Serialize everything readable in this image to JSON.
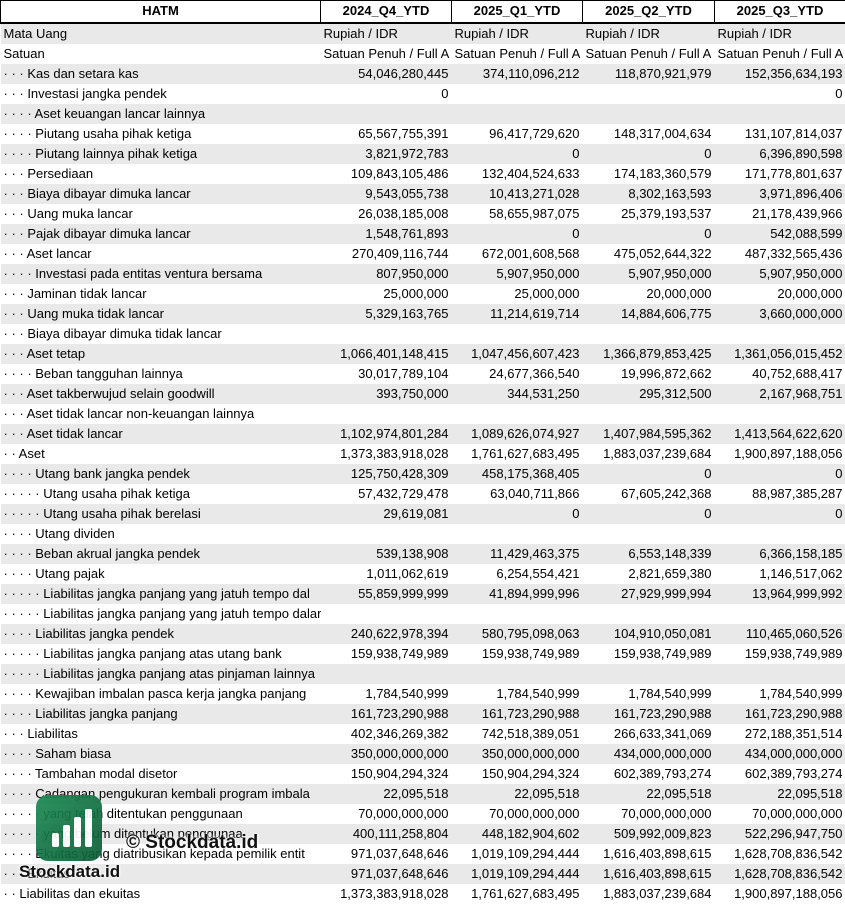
{
  "table": {
    "headers": [
      "HATM",
      "2024_Q4_YTD",
      "2025_Q1_YTD",
      "2025_Q2_YTD",
      "2025_Q3_YTD"
    ],
    "rows": [
      [
        "Mata Uang",
        "Rupiah / IDR",
        "Rupiah / IDR",
        "Rupiah / IDR",
        "Rupiah / IDR"
      ],
      [
        "Satuan",
        "Satuan Penuh / Full A",
        "Satuan Penuh / Full A",
        "Satuan Penuh / Full A",
        "Satuan Penuh / Full A"
      ],
      [
        "· · · Kas dan setara kas",
        "54,046,280,445",
        "374,110,096,212",
        "118,870,921,979",
        "152,356,634,193"
      ],
      [
        "· · · Investasi jangka pendek",
        "0",
        "",
        "",
        "0"
      ],
      [
        "· · · · Aset keuangan lancar lainnya",
        "",
        "",
        "",
        ""
      ],
      [
        "· · · · Piutang usaha pihak ketiga",
        "65,567,755,391",
        "96,417,729,620",
        "148,317,004,634",
        "131,107,814,037"
      ],
      [
        "· · · · Piutang lainnya pihak ketiga",
        "3,821,972,783",
        "0",
        "0",
        "6,396,890,598"
      ],
      [
        "· · · Persediaan",
        "109,843,105,486",
        "132,404,524,633",
        "174,183,360,579",
        "171,778,801,637"
      ],
      [
        "· · · Biaya dibayar dimuka lancar",
        "9,543,055,738",
        "10,413,271,028",
        "8,302,163,593",
        "3,971,896,406"
      ],
      [
        "· · · Uang muka lancar",
        "26,038,185,008",
        "58,655,987,075",
        "25,379,193,537",
        "21,178,439,966"
      ],
      [
        "· · · Pajak dibayar dimuka lancar",
        "1,548,761,893",
        "0",
        "0",
        "542,088,599"
      ],
      [
        "· · · Aset lancar",
        "270,409,116,744",
        "672,001,608,568",
        "475,052,644,322",
        "487,332,565,436"
      ],
      [
        "· · · · Investasi pada entitas ventura bersama",
        "807,950,000",
        "5,907,950,000",
        "5,907,950,000",
        "5,907,950,000"
      ],
      [
        "· · · Jaminan tidak lancar",
        "25,000,000",
        "25,000,000",
        "20,000,000",
        "20,000,000"
      ],
      [
        "· · · Uang muka tidak lancar",
        "5,329,163,765",
        "11,214,619,714",
        "14,884,606,775",
        "3,660,000,000"
      ],
      [
        "· · · Biaya dibayar dimuka tidak lancar",
        "",
        "",
        "",
        ""
      ],
      [
        "· · · Aset tetap",
        "1,066,401,148,415",
        "1,047,456,607,423",
        "1,366,879,853,425",
        "1,361,056,015,452"
      ],
      [
        "· · · · Beban tangguhan lainnya",
        "30,017,789,104",
        "24,677,366,540",
        "19,996,872,662",
        "40,752,688,417"
      ],
      [
        "· · · Aset takberwujud selain goodwill",
        "393,750,000",
        "344,531,250",
        "295,312,500",
        "2,167,968,751"
      ],
      [
        "· · · Aset tidak lancar non-keuangan lainnya",
        "",
        "",
        "",
        ""
      ],
      [
        "· · · Aset tidak lancar",
        "1,102,974,801,284",
        "1,089,626,074,927",
        "1,407,984,595,362",
        "1,413,564,622,620"
      ],
      [
        "· · Aset",
        "1,373,383,918,028",
        "1,761,627,683,495",
        "1,883,037,239,684",
        "1,900,897,188,056"
      ],
      [
        "· · · · Utang bank jangka pendek",
        "125,750,428,309",
        "458,175,368,405",
        "0",
        "0"
      ],
      [
        "· · · · · Utang usaha pihak ketiga",
        "57,432,729,478",
        "63,040,711,866",
        "67,605,242,368",
        "88,987,385,287"
      ],
      [
        "· · · · · Utang usaha pihak berelasi",
        "29,619,081",
        "0",
        "0",
        "0"
      ],
      [
        "· · · · Utang dividen",
        "",
        "",
        "",
        ""
      ],
      [
        "· · · · Beban akrual jangka pendek",
        "539,138,908",
        "11,429,463,375",
        "6,553,148,339",
        "6,366,158,185"
      ],
      [
        "· · · · Utang pajak",
        "1,011,062,619",
        "6,254,554,421",
        "2,821,659,380",
        "1,146,517,062"
      ],
      [
        "· · · · · Liabilitas jangka panjang yang jatuh tempo dal",
        "55,859,999,999",
        "41,894,999,996",
        "27,929,999,994",
        "13,964,999,992"
      ],
      [
        "· · · · · Liabilitas jangka panjang yang jatuh tempo dalam satu tahun atas pinjaman lainnya",
        "",
        "",
        "",
        ""
      ],
      [
        "· · · · Liabilitas jangka pendek",
        "240,622,978,394",
        "580,795,098,063",
        "104,910,050,081",
        "110,465,060,526"
      ],
      [
        "· · · · · Liabilitas jangka panjang atas utang bank",
        "159,938,749,989",
        "159,938,749,989",
        "159,938,749,989",
        "159,938,749,989"
      ],
      [
        "· · · · · Liabilitas jangka panjang atas pinjaman lainnya",
        "",
        "",
        "",
        ""
      ],
      [
        "· · · · Kewajiban imbalan pasca kerja jangka panjang",
        "1,784,540,999",
        "1,784,540,999",
        "1,784,540,999",
        "1,784,540,999"
      ],
      [
        "· · · · Liabilitas jangka panjang",
        "161,723,290,988",
        "161,723,290,988",
        "161,723,290,988",
        "161,723,290,988"
      ],
      [
        "· · · Liabilitas",
        "402,346,269,382",
        "742,518,389,051",
        "266,633,341,069",
        "272,188,351,514"
      ],
      [
        "· · · · Saham biasa",
        "350,000,000,000",
        "350,000,000,000",
        "434,000,000,000",
        "434,000,000,000"
      ],
      [
        "· · · · Tambahan modal disetor",
        "150,904,294,324",
        "150,904,294,324",
        "602,389,793,274",
        "602,389,793,274"
      ],
      [
        "· · · · Cadangan pengukuran kembali program imbala",
        "22,095,518",
        "22,095,518",
        "22,095,518",
        "22,095,518"
      ],
      [
        "· · · · · yang telah ditentukan penggunaan",
        "70,000,000,000",
        "70,000,000,000",
        "70,000,000,000",
        "70,000,000,000"
      ],
      [
        "· · · · · yang belum ditentukan penggunaa",
        "400,111,258,804",
        "448,182,904,602",
        "509,992,009,823",
        "522,296,947,750"
      ],
      [
        "· · · · Ekuitas yang diatribusikan kepada pemilik entit",
        "971,037,648,646",
        "1,019,109,294,444",
        "1,616,403,898,615",
        "1,628,708,836,542"
      ],
      [
        "· · · Ekuitas",
        "971,037,648,646",
        "1,019,109,294,444",
        "1,616,403,898,615",
        "1,628,708,836,542"
      ],
      [
        "· · Liabilitas dan ekuitas",
        "1,373,383,918,028",
        "1,761,627,683,495",
        "1,883,037,239,684",
        "1,900,897,188,056"
      ]
    ]
  },
  "watermark": {
    "name": "Stockdata.id",
    "copyright": "© Stockdata.id"
  },
  "colors": {
    "row_alt": "#e9e9e9",
    "brand_green": "#1a8a52"
  }
}
